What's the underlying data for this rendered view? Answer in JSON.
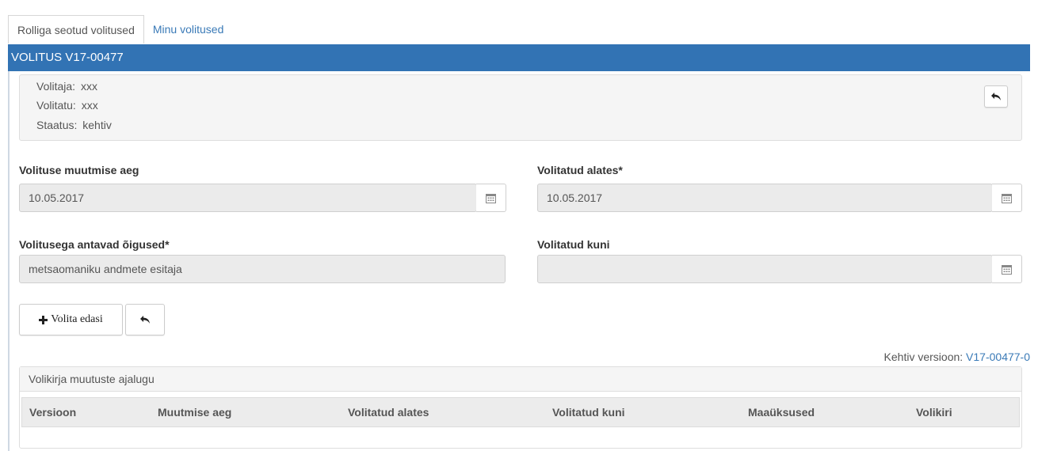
{
  "tabs": [
    {
      "label": "Rolliga seotud volitused",
      "active": true
    },
    {
      "label": "Minu volitused",
      "active": false
    }
  ],
  "panel": {
    "title": "VOLITUS V17-00477"
  },
  "info": {
    "volitaja_label": "Volitaja:",
    "volitaja_value": "xxx",
    "volitatu_label": "Volitatu:",
    "volitatu_value": "xxx",
    "staatus_label": "Staatus:",
    "staatus_value": "kehtiv"
  },
  "form": {
    "muutmise_aeg_label": "Volituse muutmise aeg",
    "muutmise_aeg_value": "10.05.2017",
    "alates_label": "Volitatud alates*",
    "alates_value": "10.05.2017",
    "oigused_label": "Volitusega antavad õigused*",
    "oigused_value": "metsaomaniku andmete esitaja",
    "kuni_label": "Volitatud kuni",
    "kuni_value": ""
  },
  "actions": {
    "volita_edasi": "Volita edasi"
  },
  "version": {
    "label": "Kehtiv versioon:",
    "link": "V17-00477-0"
  },
  "history": {
    "title": "Volikirja muutuste ajalugu",
    "columns": [
      "Versioon",
      "Muutmise aeg",
      "Volitatud alates",
      "Volitatud kuni",
      "Maaüksused",
      "Volikiri"
    ]
  },
  "icons": {
    "back": "reply-arrow-icon",
    "calendar": "calendar-icon",
    "plus": "plus-icon"
  },
  "colors": {
    "header": "#3273b4",
    "link": "#3a7ab7"
  }
}
